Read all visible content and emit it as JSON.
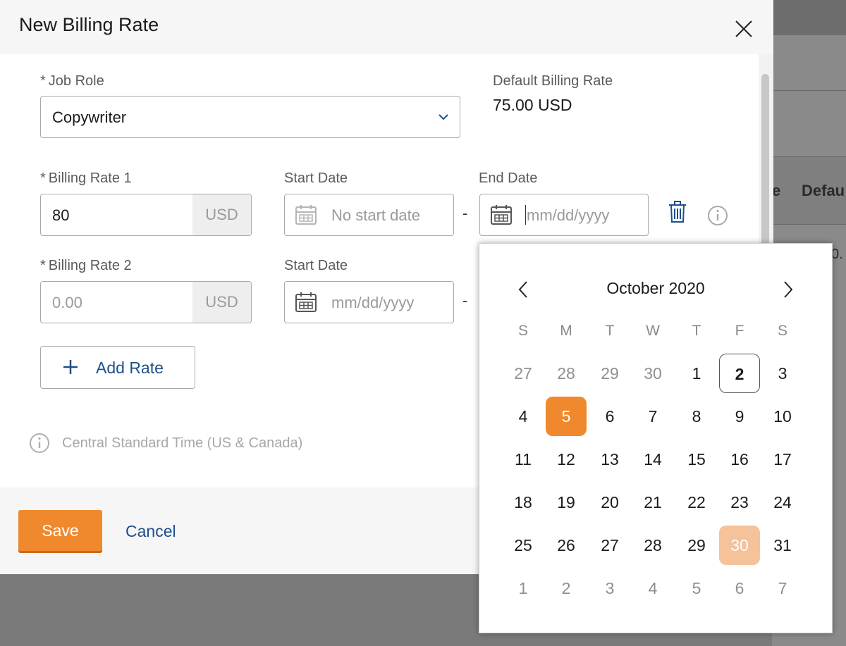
{
  "modal": {
    "title": "New Billing Rate",
    "close_icon": "close-icon"
  },
  "job_role": {
    "label": "Job Role",
    "required_marker": "*",
    "value": "Copywriter"
  },
  "default_rate": {
    "label": "Default Billing Rate",
    "value": "75.00 USD"
  },
  "rates": [
    {
      "label": "Billing Rate 1",
      "required_marker": "*",
      "value": "80",
      "currency": "USD",
      "start_label": "Start Date",
      "start_value": "No start date",
      "end_label": "End Date",
      "end_placeholder": "mm/dd/yyyy",
      "separator": "-"
    },
    {
      "label": "Billing Rate 2",
      "required_marker": "*",
      "placeholder": "0.00",
      "currency": "USD",
      "start_label": "Start Date",
      "start_placeholder": "mm/dd/yyyy",
      "separator": "-"
    }
  ],
  "add_rate": {
    "label": "Add Rate"
  },
  "timezone": {
    "text": "Central Standard Time (US & Canada)"
  },
  "footer": {
    "save_label": "Save",
    "cancel_label": "Cancel"
  },
  "background": {
    "header_fragment_1": "e",
    "header_fragment_2": "Defau",
    "cell_fragment": "0."
  },
  "calendar": {
    "month_label": "October 2020",
    "days_of_week": [
      "S",
      "M",
      "T",
      "W",
      "T",
      "F",
      "S"
    ],
    "weeks": [
      [
        {
          "d": "27",
          "m": true
        },
        {
          "d": "28",
          "m": true
        },
        {
          "d": "29",
          "m": true
        },
        {
          "d": "30",
          "m": true
        },
        {
          "d": "1"
        },
        {
          "d": "2",
          "today": true
        },
        {
          "d": "3"
        }
      ],
      [
        {
          "d": "4"
        },
        {
          "d": "5",
          "selected": true
        },
        {
          "d": "6"
        },
        {
          "d": "7"
        },
        {
          "d": "8"
        },
        {
          "d": "9"
        },
        {
          "d": "10"
        }
      ],
      [
        {
          "d": "11"
        },
        {
          "d": "12"
        },
        {
          "d": "13"
        },
        {
          "d": "14"
        },
        {
          "d": "15"
        },
        {
          "d": "16"
        },
        {
          "d": "17"
        }
      ],
      [
        {
          "d": "18"
        },
        {
          "d": "19"
        },
        {
          "d": "20"
        },
        {
          "d": "21"
        },
        {
          "d": "22"
        },
        {
          "d": "23"
        },
        {
          "d": "24"
        }
      ],
      [
        {
          "d": "25"
        },
        {
          "d": "26"
        },
        {
          "d": "27"
        },
        {
          "d": "28"
        },
        {
          "d": "29"
        },
        {
          "d": "30",
          "hover": true
        },
        {
          "d": "31"
        }
      ],
      [
        {
          "d": "1",
          "m": true
        },
        {
          "d": "2",
          "m": true
        },
        {
          "d": "3",
          "m": true
        },
        {
          "d": "4",
          "m": true
        },
        {
          "d": "5",
          "m": true
        },
        {
          "d": "6",
          "m": true
        },
        {
          "d": "7",
          "m": true
        }
      ]
    ]
  },
  "colors": {
    "accent_orange": "#f0892e",
    "hover_orange": "#f6c29a",
    "link_blue": "#1d4f8c",
    "overlay_gray": "#7a7a7a"
  }
}
